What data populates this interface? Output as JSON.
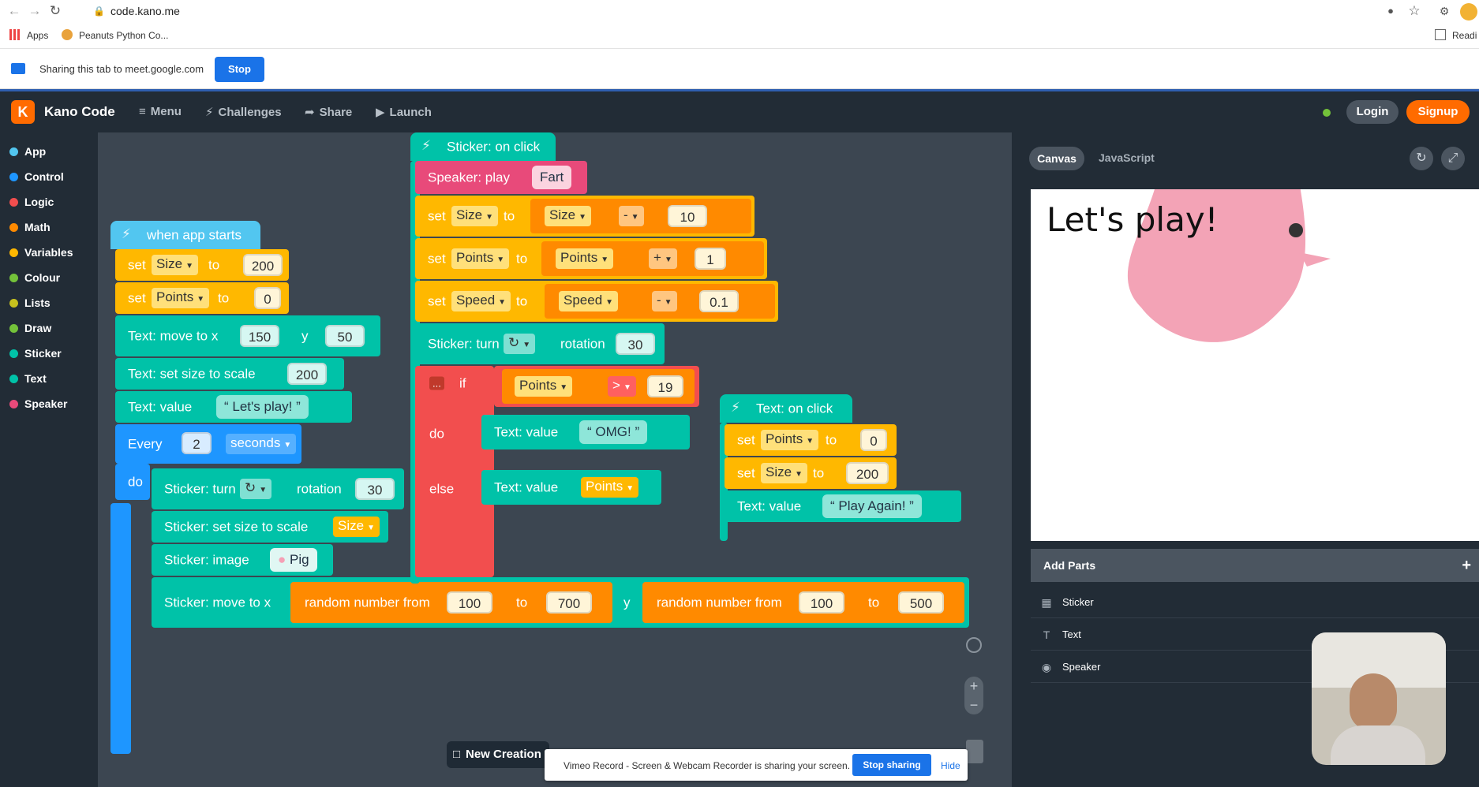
{
  "browser": {
    "url": "code.kano.me",
    "bookmarks": [
      {
        "label": "Apps"
      },
      {
        "label": "Peanuts Python Co..."
      }
    ],
    "reading_list": "Readi"
  },
  "sharebar": {
    "message": "Sharing this tab to meet.google.com",
    "stop_label": "Stop"
  },
  "nav": {
    "app_name": "Kano Code",
    "logo_letter": "K",
    "items": [
      "Menu",
      "Challenges",
      "Share",
      "Launch"
    ],
    "login_label": "Login",
    "signup_label": "Signup"
  },
  "categories": [
    {
      "label": "App",
      "color": "#52c6f0"
    },
    {
      "label": "Control",
      "color": "#1e96ff"
    },
    {
      "label": "Logic",
      "color": "#f24e4e"
    },
    {
      "label": "Math",
      "color": "#ff8a00"
    },
    {
      "label": "Variables",
      "color": "#ffb800"
    },
    {
      "label": "Colour",
      "color": "#74c23a"
    },
    {
      "label": "Lists",
      "color": "#c8c21e"
    },
    {
      "label": "Draw",
      "color": "#74c23a"
    },
    {
      "label": "Sticker",
      "color": "#00c2a8"
    },
    {
      "label": "Text",
      "color": "#00c2a8"
    },
    {
      "label": "Speaker",
      "color": "#e84a7a"
    }
  ],
  "blocks": {
    "when_app_starts": "when app starts",
    "set": "set",
    "to": "to",
    "size": "Size",
    "points": "Points",
    "speed": "Speed",
    "v200": "200",
    "v0": "0",
    "text_move": "Text: move to x",
    "y": "y",
    "v150": "150",
    "v50": "50",
    "text_size": "Text: set size to scale",
    "text_value": "Text: value",
    "lets_play": "Let's play!",
    "every": "Every",
    "v2": "2",
    "seconds": "seconds",
    "do": "do",
    "sticker_turn": "Sticker: turn",
    "rotation": "rotation",
    "v30": "30",
    "sticker_size": "Sticker: set size to scale",
    "sticker_image": "Sticker: image",
    "pig": "Pig",
    "sticker_move": "Sticker: move to x",
    "random_from": "random number from",
    "v100": "100",
    "v700": "700",
    "v500": "500",
    "sticker_onclick": "Sticker: on click",
    "speaker_play": "Speaker: play",
    "fart": "Fart",
    "minus": "-",
    "plus": "+",
    "v10": "10",
    "v1": "1",
    "v01": "0.1",
    "if": "if",
    "gt": ">",
    "v19": "19",
    "omg": "OMG!",
    "else": "else",
    "text_onclick": "Text: on click",
    "play_again": "Play Again!",
    "more": "..."
  },
  "right": {
    "tab_canvas": "Canvas",
    "tab_js": "JavaScript",
    "canvas_text": "Let's play!",
    "add_parts": "Add Parts",
    "parts": [
      "Sticker",
      "Text",
      "Speaker"
    ]
  },
  "new_creation": "New Creation",
  "vimeo": {
    "message": "Vimeo Record - Screen & Webcam Recorder is sharing your screen.",
    "stop_label": "Stop sharing",
    "hide_label": "Hide"
  }
}
